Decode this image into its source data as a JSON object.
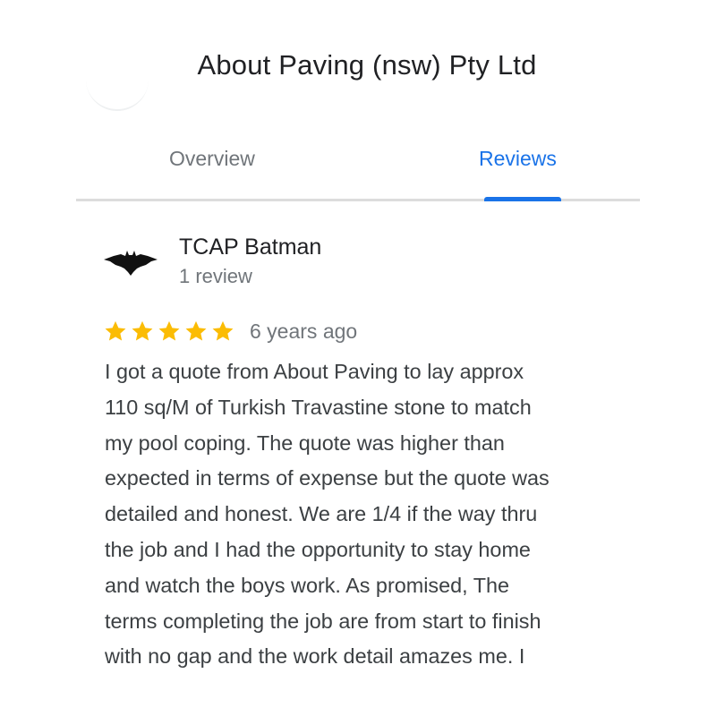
{
  "business": {
    "name": "About Paving (nsw) Pty Ltd"
  },
  "tabs": [
    {
      "label": "Overview",
      "active": false
    },
    {
      "label": "Reviews",
      "active": true
    }
  ],
  "accent_color": "#1a73e8",
  "star_color": "#fbbc04",
  "review": {
    "reviewer": {
      "name": "TCAP Batman",
      "review_count": "1 review",
      "avatar": "batman-logo-icon"
    },
    "rating": 5,
    "age": "6 years ago",
    "lines": [
      "I got a quote from About Paving to lay approx",
      "110 sq/M of Turkish Travastine stone to match",
      "my pool coping. The quote was higher than",
      "expected in terms of expense but the quote was",
      "detailed and honest. We are 1/4 if the way thru",
      "the job and I had the opportunity to stay home",
      "and watch the boys work. As promised, The",
      "terms completing the job are from start to finish",
      "with no gap and the work detail amazes me. I"
    ]
  }
}
